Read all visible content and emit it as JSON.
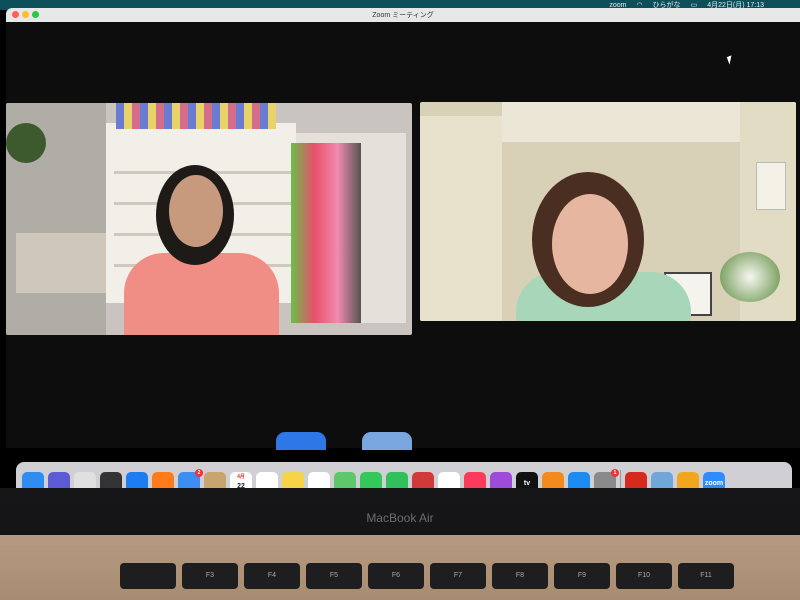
{
  "menubar": {
    "app": "zoom",
    "input_method": "ひらがな",
    "datetime": "4月22日(月)  17:13"
  },
  "window": {
    "title": "Zoom ミーティング"
  },
  "dock": {
    "apps": [
      {
        "name": "finder",
        "color": "#2f8cf2"
      },
      {
        "name": "siri",
        "color": "#5b5bd6"
      },
      {
        "name": "launchpad",
        "color": "#e0e0e0"
      },
      {
        "name": "mission-control",
        "color": "#333"
      },
      {
        "name": "safari",
        "color": "#1e7cf2"
      },
      {
        "name": "firefox",
        "color": "#ff7a1a"
      },
      {
        "name": "mail",
        "color": "#3d8ef2",
        "badge": "2"
      },
      {
        "name": "contacts",
        "color": "#c8a46e"
      },
      {
        "name": "calendar",
        "color": "#ffffff",
        "label": "22",
        "sublabel": "4月"
      },
      {
        "name": "reminders",
        "color": "#ffffff"
      },
      {
        "name": "notes",
        "color": "#f7d348"
      },
      {
        "name": "freeform",
        "color": "#ffffff"
      },
      {
        "name": "maps",
        "color": "#5ec66b"
      },
      {
        "name": "messages",
        "color": "#34c759"
      },
      {
        "name": "facetime",
        "color": "#32c05a"
      },
      {
        "name": "photo-booth",
        "color": "#d23a3a"
      },
      {
        "name": "photos",
        "color": "#ffffff"
      },
      {
        "name": "music",
        "color": "#fa3c5a"
      },
      {
        "name": "podcasts",
        "color": "#9d4bd8"
      },
      {
        "name": "tv",
        "color": "#111111",
        "label": "tv"
      },
      {
        "name": "books",
        "color": "#f28a1e"
      },
      {
        "name": "app-store",
        "color": "#1d8cf2"
      },
      {
        "name": "system-settings",
        "color": "#8a8a8a",
        "badge": "1"
      },
      {
        "name": "acrobat",
        "color": "#d62a1e"
      },
      {
        "name": "preview",
        "color": "#6fa8d8"
      },
      {
        "name": "pages",
        "color": "#f2a61e"
      },
      {
        "name": "zoom",
        "color": "#2d8cff",
        "label": "zoom"
      }
    ]
  },
  "laptop": {
    "brand": "MacBook Air"
  },
  "keyboard": {
    "keys": [
      "",
      "F3",
      "F4",
      "F5",
      "F6",
      "F7",
      "F8",
      "F9",
      "F10",
      "F11"
    ]
  }
}
